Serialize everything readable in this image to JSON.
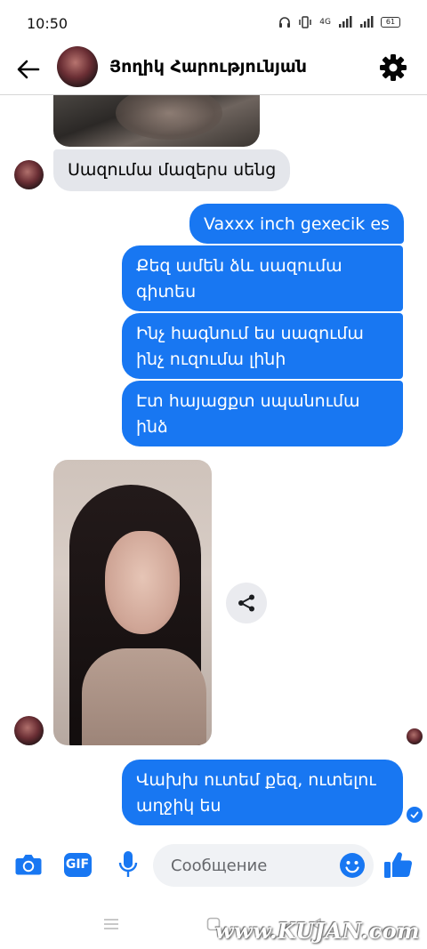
{
  "status_bar": {
    "time": "10:50",
    "signal_text": "4G",
    "battery_level": "61"
  },
  "header": {
    "contact_name": "Յողիկ Հարությունյան",
    "icons": {
      "back": "arrow-left-icon",
      "settings": "gear-icon"
    }
  },
  "messages": [
    {
      "direction": "incoming",
      "type": "image"
    },
    {
      "direction": "incoming",
      "type": "text",
      "text": "Սազումա մազերս սենց"
    },
    {
      "direction": "outgoing",
      "type": "text",
      "text": "Vaxxx inch gexecik es"
    },
    {
      "direction": "outgoing",
      "type": "text",
      "lines": [
        "Քեզ ամեն ձև սազումա",
        "գիտես"
      ]
    },
    {
      "direction": "outgoing",
      "type": "text",
      "lines": [
        "Ինչ հագնում ես սազումա",
        "ինչ ուզումա լինի"
      ]
    },
    {
      "direction": "outgoing",
      "type": "text",
      "lines": [
        "Էտ հայացքտ սպանումա",
        "ինձ"
      ]
    },
    {
      "direction": "incoming",
      "type": "image"
    },
    {
      "direction": "outgoing",
      "type": "text",
      "lines": [
        "Վախխ ուտեմ քեզ, ուտելու",
        "աղջիկ ես"
      ]
    }
  ],
  "composer": {
    "placeholder": "Сообщение",
    "gif_label": "GIF",
    "icons": {
      "camera": "camera-icon",
      "gif": "gif-icon",
      "mic": "microphone-icon",
      "emoji": "emoji-icon",
      "like": "thumbs-up-icon"
    }
  },
  "watermark": "www.KUJAN.com",
  "colors": {
    "accent": "#1877f2",
    "incoming_bubble": "#e4e6eb",
    "outgoing_text": "#ffffff"
  }
}
